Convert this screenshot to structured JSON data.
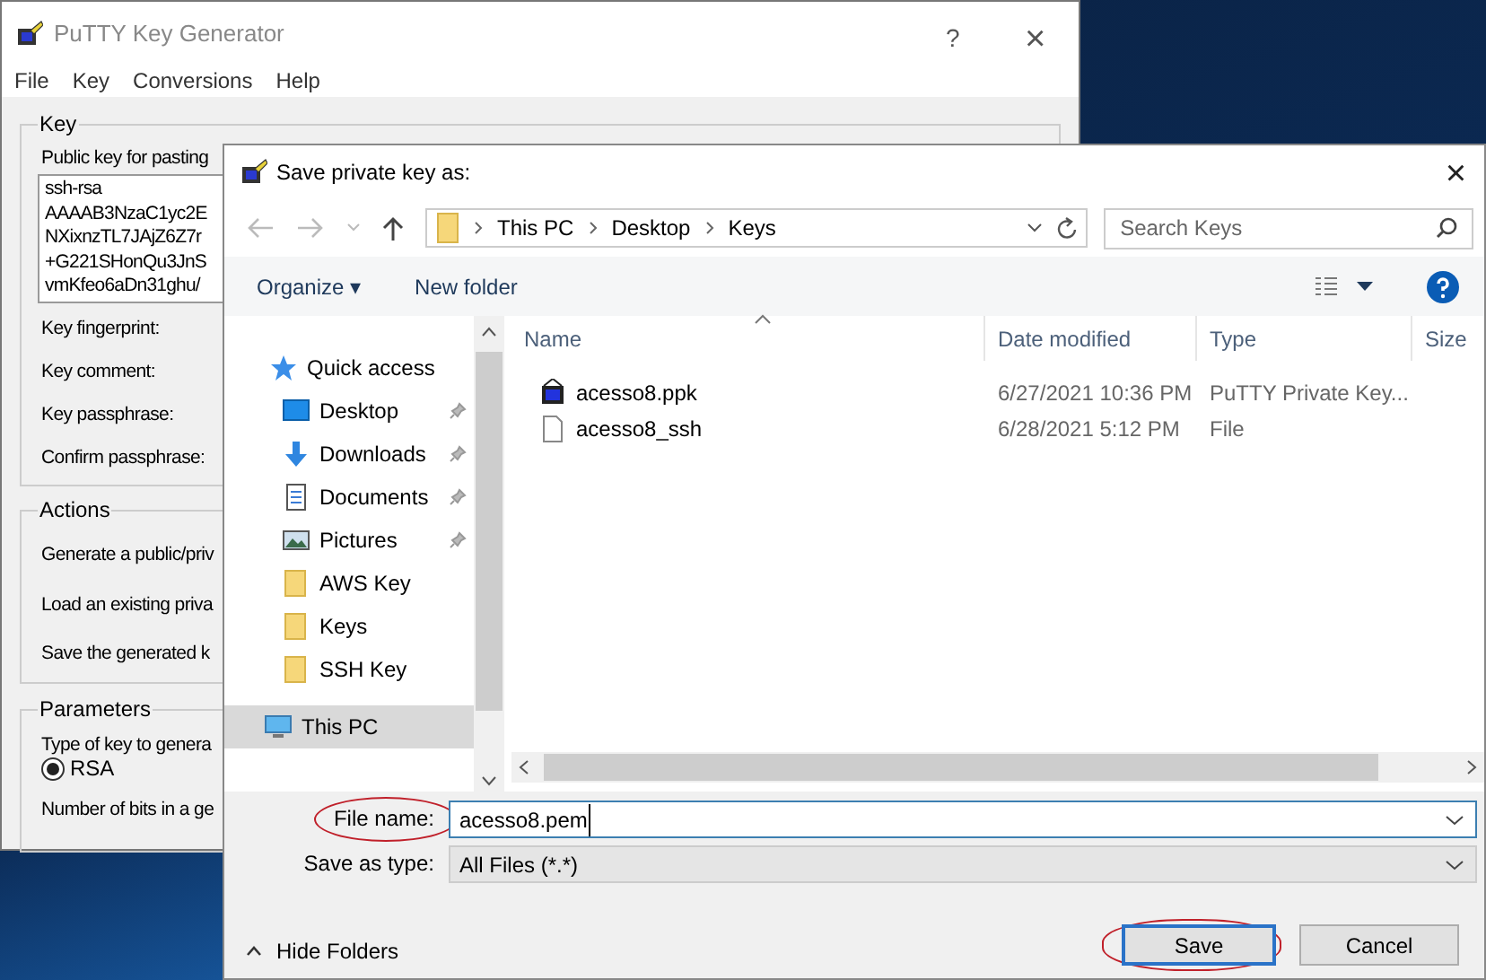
{
  "putty_window": {
    "title": "PuTTY Key Generator",
    "help_button": "?",
    "close_button": "×",
    "menu": [
      "File",
      "Key",
      "Conversions",
      "Help"
    ],
    "key_group": {
      "title": "Key",
      "public_key_label": "Public key for pasting",
      "public_key_lines": [
        "ssh-rsa",
        "AAAAB3NzaC1yc2E",
        "NXixnzTL7JAjZ6Z7r",
        "+G221SHonQu3JnS",
        "vmKfeo6aDn31ghu/"
      ],
      "fields": [
        "Key fingerprint:",
        "Key comment:",
        "Key passphrase:",
        "Confirm passphrase:"
      ]
    },
    "actions_group": {
      "title": "Actions",
      "rows": [
        "Generate a public/priv",
        "Load an existing priva",
        "Save the generated k"
      ]
    },
    "parameters_group": {
      "title": "Parameters",
      "type_label": "Type of key to genera",
      "radios": [
        {
          "label": "RSA",
          "selected": true
        }
      ],
      "bits_label": "Number of bits in a ge"
    }
  },
  "save_dialog": {
    "title": "Save private key as:",
    "close_button": "×",
    "breadcrumb": [
      "This PC",
      "Desktop",
      "Keys"
    ],
    "search": {
      "placeholder": "Search Keys"
    },
    "toolbar": {
      "organize": "Organize ▾",
      "new_folder": "New folder"
    },
    "nav_items": [
      {
        "label": "Quick access",
        "kind": "star",
        "pinned": false,
        "selected": false
      },
      {
        "label": "Desktop",
        "kind": "desktop",
        "pinned": true,
        "selected": false
      },
      {
        "label": "Downloads",
        "kind": "download",
        "pinned": true,
        "selected": false
      },
      {
        "label": "Documents",
        "kind": "document",
        "pinned": true,
        "selected": false
      },
      {
        "label": "Pictures",
        "kind": "picture",
        "pinned": true,
        "selected": false
      },
      {
        "label": "AWS Key",
        "kind": "folder",
        "pinned": false,
        "selected": false
      },
      {
        "label": "Keys",
        "kind": "folder",
        "pinned": false,
        "selected": false
      },
      {
        "label": "SSH Key",
        "kind": "folder",
        "pinned": false,
        "selected": false
      },
      {
        "label": "This PC",
        "kind": "computer",
        "pinned": false,
        "selected": true
      }
    ],
    "columns": [
      "Name",
      "Date modified",
      "Type",
      "Size"
    ],
    "files": [
      {
        "kind": "putty",
        "name": "acesso8.ppk",
        "date": "6/27/2021 10:36 PM",
        "type": "PuTTY Private Key..."
      },
      {
        "kind": "file",
        "name": "acesso8_ssh",
        "date": "6/28/2021 5:12 PM",
        "type": "File"
      }
    ],
    "file_name": {
      "label": "File name:",
      "value": "acesso8.pem",
      "annotated": true
    },
    "save_as_type": {
      "label": "Save as type:",
      "value": "All Files (*.*)"
    },
    "hide_folders": "Hide Folders",
    "buttons": [
      {
        "label": "Save",
        "default": true,
        "annotated": true
      },
      {
        "label": "Cancel",
        "default": false,
        "annotated": false
      }
    ]
  }
}
